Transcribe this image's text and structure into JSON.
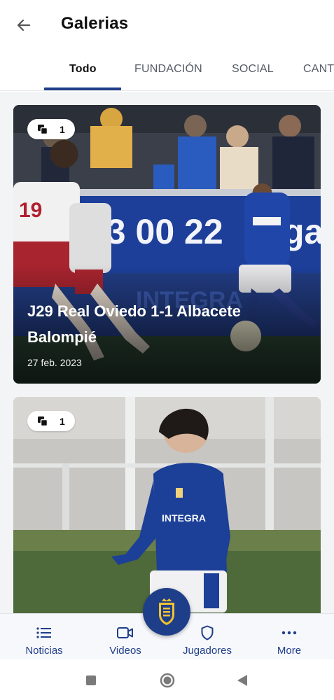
{
  "header": {
    "title": "Galerias",
    "back_icon": "arrow-left-icon"
  },
  "tabs": [
    {
      "label": "Todo",
      "active": true
    },
    {
      "label": "FUNDACIÓN",
      "active": false
    },
    {
      "label": "SOCIAL",
      "active": false
    },
    {
      "label": "CANT",
      "active": false
    }
  ],
  "galleries": [
    {
      "count": "1",
      "title": "J29 Real Oviedo 1-1 Albacete Balompié",
      "date": "27 feb. 2023",
      "image": "match-action-photo"
    },
    {
      "count": "1",
      "title": "",
      "date": "",
      "image": "youth-player-photo"
    }
  ],
  "bottom_nav": [
    {
      "label": "Noticias",
      "icon": "list-icon"
    },
    {
      "label": "Videos",
      "icon": "video-camera-icon"
    },
    {
      "label": "Jugadores",
      "icon": "shield-icon"
    },
    {
      "label": "More",
      "icon": "more-dots-icon"
    }
  ],
  "fab": {
    "icon": "club-crest-icon"
  },
  "colors": {
    "accent": "#1f3e8a",
    "surface": "#f3f4f6"
  }
}
